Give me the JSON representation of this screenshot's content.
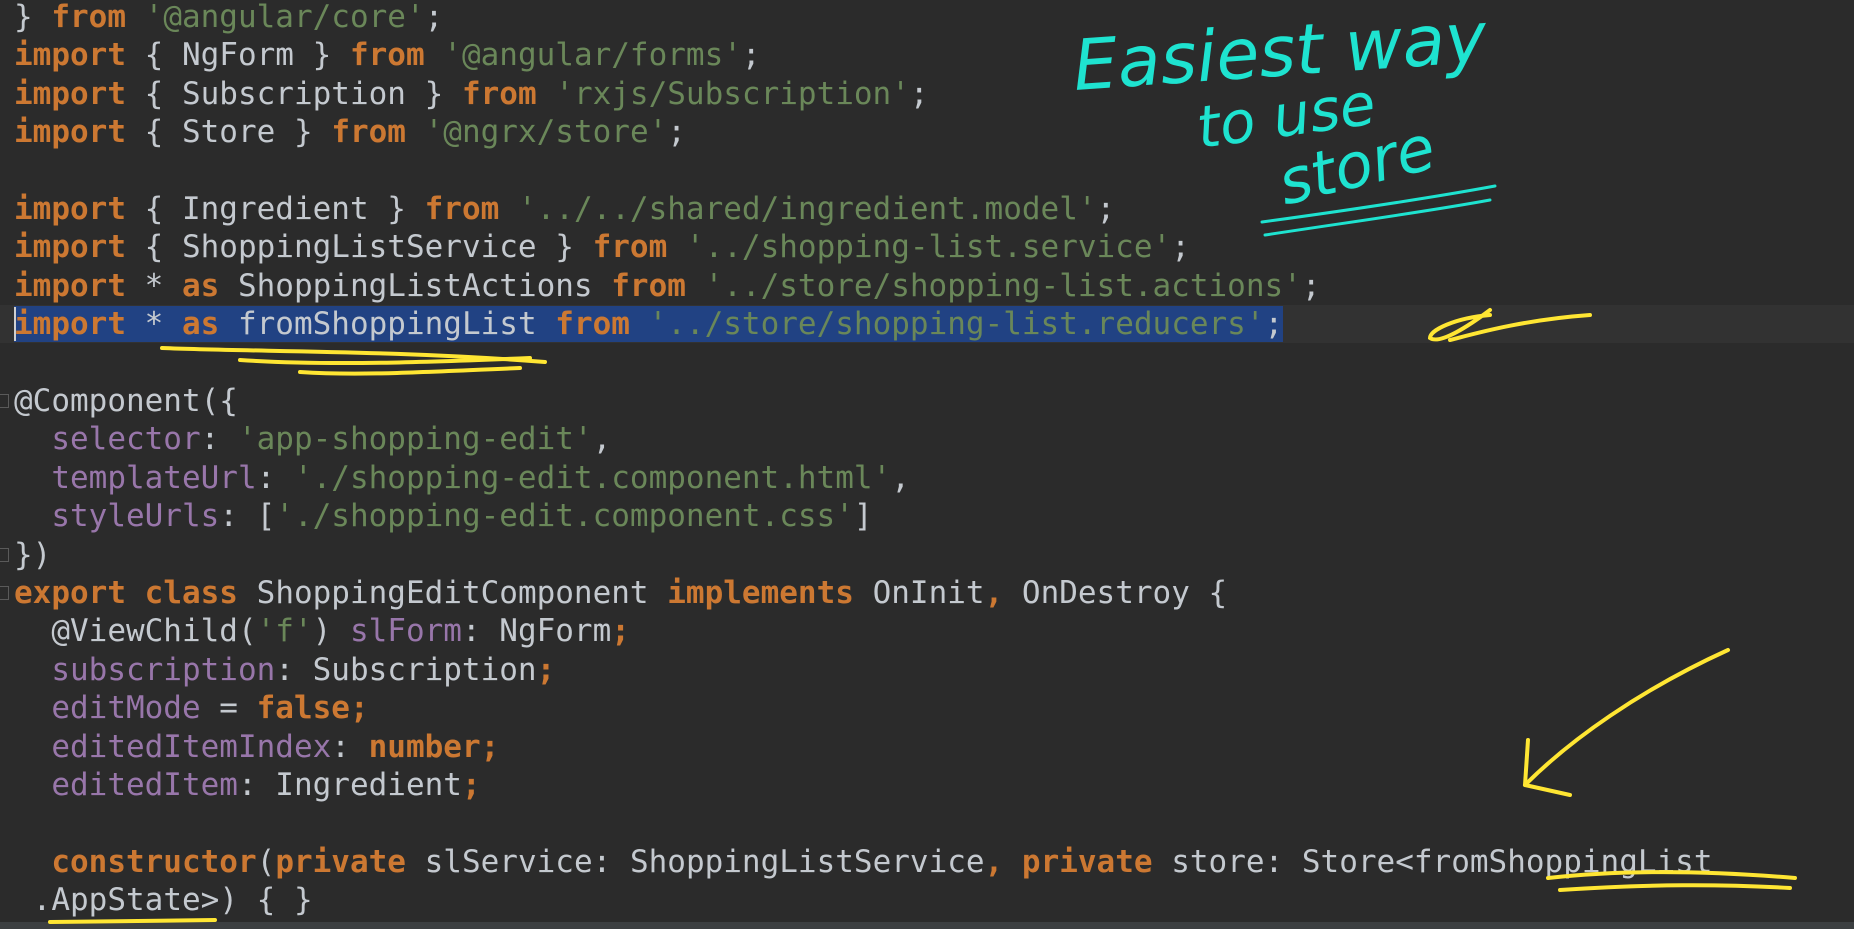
{
  "editor": {
    "lines": [
      {
        "tokens": [
          [
            "t-punct",
            "} "
          ],
          [
            "t-kw",
            "from"
          ],
          [
            "t-punct",
            " "
          ],
          [
            "t-str",
            "'@angular/core'"
          ],
          [
            "t-punct",
            ";"
          ]
        ]
      },
      {
        "tokens": [
          [
            "t-kw",
            "import"
          ],
          [
            "t-punct",
            " { "
          ],
          [
            "t-id",
            "NgForm"
          ],
          [
            "t-punct",
            " } "
          ],
          [
            "t-kw",
            "from"
          ],
          [
            "t-punct",
            " "
          ],
          [
            "t-str",
            "'@angular/forms'"
          ],
          [
            "t-punct",
            ";"
          ]
        ]
      },
      {
        "tokens": [
          [
            "t-kw",
            "import"
          ],
          [
            "t-punct",
            " { "
          ],
          [
            "t-id",
            "Subscription"
          ],
          [
            "t-punct",
            " } "
          ],
          [
            "t-kw",
            "from"
          ],
          [
            "t-punct",
            " "
          ],
          [
            "t-str",
            "'rxjs/Subscription'"
          ],
          [
            "t-punct",
            ";"
          ]
        ]
      },
      {
        "tokens": [
          [
            "t-kw",
            "import"
          ],
          [
            "t-punct",
            " { "
          ],
          [
            "t-id",
            "Store"
          ],
          [
            "t-punct",
            " } "
          ],
          [
            "t-kw",
            "from"
          ],
          [
            "t-punct",
            " "
          ],
          [
            "t-str",
            "'@ngrx/store'"
          ],
          [
            "t-punct",
            ";"
          ]
        ]
      },
      {
        "tokens": []
      },
      {
        "tokens": [
          [
            "t-kw",
            "import"
          ],
          [
            "t-punct",
            " { "
          ],
          [
            "t-id",
            "Ingredient"
          ],
          [
            "t-punct",
            " } "
          ],
          [
            "t-kw",
            "from"
          ],
          [
            "t-punct",
            " "
          ],
          [
            "t-str",
            "'../../shared/ingredient.model'"
          ],
          [
            "t-punct",
            ";"
          ]
        ]
      },
      {
        "tokens": [
          [
            "t-kw",
            "import"
          ],
          [
            "t-punct",
            " { "
          ],
          [
            "t-id",
            "ShoppingListService"
          ],
          [
            "t-punct",
            " } "
          ],
          [
            "t-kw",
            "from"
          ],
          [
            "t-punct",
            " "
          ],
          [
            "t-str",
            "'../shopping-list.service'"
          ],
          [
            "t-punct",
            ";"
          ]
        ]
      },
      {
        "tokens": [
          [
            "t-kw",
            "import"
          ],
          [
            "t-punct",
            " * "
          ],
          [
            "t-kw",
            "as"
          ],
          [
            "t-punct",
            " "
          ],
          [
            "t-id",
            "ShoppingListActions"
          ],
          [
            "t-punct",
            " "
          ],
          [
            "t-kw",
            "from"
          ],
          [
            "t-punct",
            " "
          ],
          [
            "t-str",
            "'../store/shopping-list.actions'"
          ],
          [
            "t-punct",
            ";"
          ]
        ]
      },
      {
        "tokens": [
          [
            "t-kw",
            "import"
          ],
          [
            "t-punct",
            " * "
          ],
          [
            "t-kw",
            "as"
          ],
          [
            "t-punct",
            " "
          ],
          [
            "t-id",
            "fromShoppingList"
          ],
          [
            "t-punct",
            " "
          ],
          [
            "t-kw",
            "from"
          ],
          [
            "t-punct",
            " "
          ],
          [
            "t-str",
            "'../store/shopping-list.reducers'"
          ],
          [
            "t-punct",
            ";"
          ]
        ],
        "selected": true,
        "current": true
      },
      {
        "tokens": []
      },
      {
        "tokens": [
          [
            "t-ann",
            "@Component"
          ],
          [
            "t-punct",
            "({"
          ]
        ]
      },
      {
        "tokens": [
          [
            "t-punct",
            "  "
          ],
          [
            "t-prop",
            "selector"
          ],
          [
            "t-punct",
            ": "
          ],
          [
            "t-str",
            "'app-shopping-edit'"
          ],
          [
            "t-punct",
            ","
          ]
        ]
      },
      {
        "tokens": [
          [
            "t-punct",
            "  "
          ],
          [
            "t-prop",
            "templateUrl"
          ],
          [
            "t-punct",
            ": "
          ],
          [
            "t-str",
            "'./shopping-edit.component.html'"
          ],
          [
            "t-punct",
            ","
          ]
        ]
      },
      {
        "tokens": [
          [
            "t-punct",
            "  "
          ],
          [
            "t-prop",
            "styleUrls"
          ],
          [
            "t-punct",
            ": ["
          ],
          [
            "t-str",
            "'./shopping-edit.component.css'"
          ],
          [
            "t-punct",
            "]"
          ]
        ]
      },
      {
        "tokens": [
          [
            "t-punct",
            "})"
          ]
        ]
      },
      {
        "tokens": [
          [
            "t-kw",
            "export"
          ],
          [
            "t-punct",
            " "
          ],
          [
            "t-kw",
            "class"
          ],
          [
            "t-punct",
            " "
          ],
          [
            "t-id",
            "ShoppingEditComponent"
          ],
          [
            "t-punct",
            " "
          ],
          [
            "t-kw",
            "implements"
          ],
          [
            "t-punct",
            " "
          ],
          [
            "t-id",
            "OnInit"
          ],
          [
            "t-kw",
            ","
          ],
          [
            "t-punct",
            " "
          ],
          [
            "t-id",
            "OnDestroy"
          ],
          [
            "t-punct",
            " {"
          ]
        ]
      },
      {
        "tokens": [
          [
            "t-punct",
            "  "
          ],
          [
            "t-ann",
            "@ViewChild"
          ],
          [
            "t-punct",
            "("
          ],
          [
            "t-str",
            "'f'"
          ],
          [
            "t-punct",
            ") "
          ],
          [
            "t-prop",
            "slForm"
          ],
          [
            "t-punct",
            ": "
          ],
          [
            "t-id",
            "NgForm"
          ],
          [
            "t-kw",
            ";"
          ]
        ]
      },
      {
        "tokens": [
          [
            "t-punct",
            "  "
          ],
          [
            "t-prop",
            "subscription"
          ],
          [
            "t-punct",
            ": "
          ],
          [
            "t-id",
            "Subscription"
          ],
          [
            "t-kw",
            ";"
          ]
        ]
      },
      {
        "tokens": [
          [
            "t-punct",
            "  "
          ],
          [
            "t-prop",
            "editMode"
          ],
          [
            "t-punct",
            " = "
          ],
          [
            "t-kw",
            "false"
          ],
          [
            "t-kw",
            ";"
          ]
        ]
      },
      {
        "tokens": [
          [
            "t-punct",
            "  "
          ],
          [
            "t-prop",
            "editedItemIndex"
          ],
          [
            "t-punct",
            ": "
          ],
          [
            "t-kw",
            "number"
          ],
          [
            "t-kw",
            ";"
          ]
        ]
      },
      {
        "tokens": [
          [
            "t-punct",
            "  "
          ],
          [
            "t-prop",
            "editedItem"
          ],
          [
            "t-punct",
            ": "
          ],
          [
            "t-id",
            "Ingredient"
          ],
          [
            "t-kw",
            ";"
          ]
        ]
      },
      {
        "tokens": []
      },
      {
        "tokens": [
          [
            "t-punct",
            "  "
          ],
          [
            "t-kw",
            "constructor"
          ],
          [
            "t-punct",
            "("
          ],
          [
            "t-kw",
            "private"
          ],
          [
            "t-punct",
            " "
          ],
          [
            "t-id",
            "slService"
          ],
          [
            "t-punct",
            ": "
          ],
          [
            "t-id",
            "ShoppingListService"
          ],
          [
            "t-kw",
            ","
          ],
          [
            "t-punct",
            " "
          ],
          [
            "t-kw",
            "private"
          ],
          [
            "t-punct",
            " "
          ],
          [
            "t-id",
            "store"
          ],
          [
            "t-punct",
            ": "
          ],
          [
            "t-id",
            "Store"
          ],
          [
            "t-punct",
            "<"
          ],
          [
            "t-id",
            "fromShoppingList"
          ]
        ]
      },
      {
        "tokens": [
          [
            "t-punct",
            " "
          ],
          [
            "t-id",
            ".AppState"
          ],
          [
            "t-punct",
            ">) { }"
          ]
        ]
      }
    ]
  },
  "annotations": {
    "note_line1": "Easiest way",
    "note_line2": "to use",
    "note_line3": "store",
    "arrow_glyph": "∠",
    "ink_color_cyan": "#1ee3d0",
    "ink_color_yellow": "#ffe633"
  }
}
